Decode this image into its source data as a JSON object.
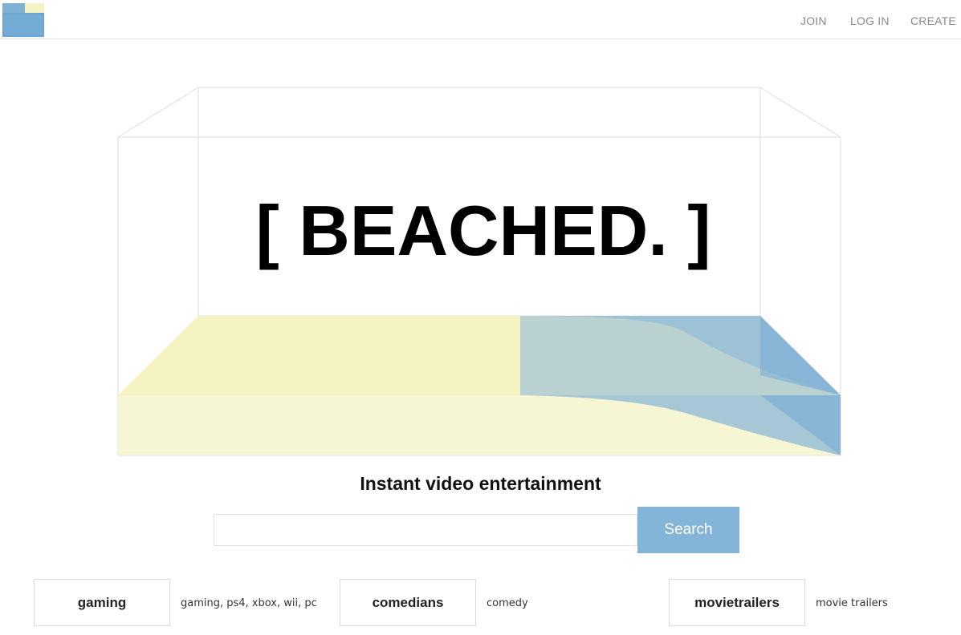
{
  "nav": {
    "join": "JOIN",
    "login": "LOG IN",
    "create": "CREATE"
  },
  "hero": {
    "brand": "[ BEACHED. ]",
    "sand_color": "#f5f3c2",
    "water_color": "#85b4d9"
  },
  "tagline": "Instant video entertainment",
  "search": {
    "value": "",
    "placeholder": "",
    "button_label": "Search"
  },
  "channels": [
    {
      "name": "gaming",
      "tags": "gaming, ps4, xbox, wii, pc"
    },
    {
      "name": "comedians",
      "tags": "comedy"
    },
    {
      "name": "movietrailers",
      "tags": "movie trailers"
    }
  ],
  "icons": {
    "logo": "beach-logo-icon"
  }
}
